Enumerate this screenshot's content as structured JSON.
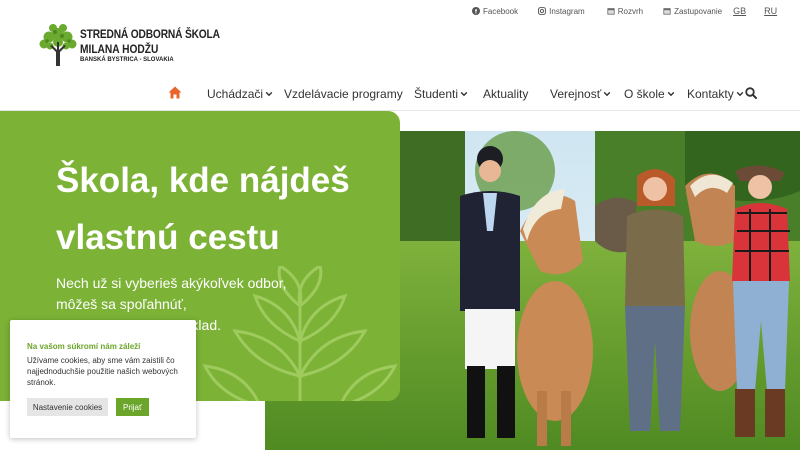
{
  "toplinks": {
    "facebook": "Facebook",
    "instagram": "Instagram",
    "rozvrh": "Rozvrh",
    "zastupovanie": "Zastupovanie",
    "lang_gb": "GB",
    "lang_ru": "RU"
  },
  "logo": {
    "line1": "STREDNÁ ODBORNÁ ŠKOLA",
    "line2": "MILANA HODŽU",
    "line3": "BANSKÁ BYSTRICA - SLOVAKIA"
  },
  "nav": {
    "items": [
      "Uchádzači",
      "Vzdelávacie programy",
      "Študenti",
      "Aktuality",
      "Verejnosť",
      "O škole",
      "Kontakty"
    ]
  },
  "hero": {
    "title_line1": "Škola, kde nájdeš",
    "title_line2": "vlastnú cestu",
    "sub_line1": "Nech už si vyberieš akýkoľvek odbor,",
    "sub_line2": "môžeš sa spoľahnúť,",
    "sub_line3": "že dostaneš pevný základ."
  },
  "cookie": {
    "title": "Na vašom súkromí nám záleží",
    "text": "Užívame cookies, aby sme vám zaistili čo najjednoduchšie použitie našich webových stránok.",
    "settings_label": "Nastavenie cookies",
    "accept_label": "Prijať"
  },
  "colors": {
    "accent_green": "#7cb236",
    "home_icon": "#e8662b"
  }
}
